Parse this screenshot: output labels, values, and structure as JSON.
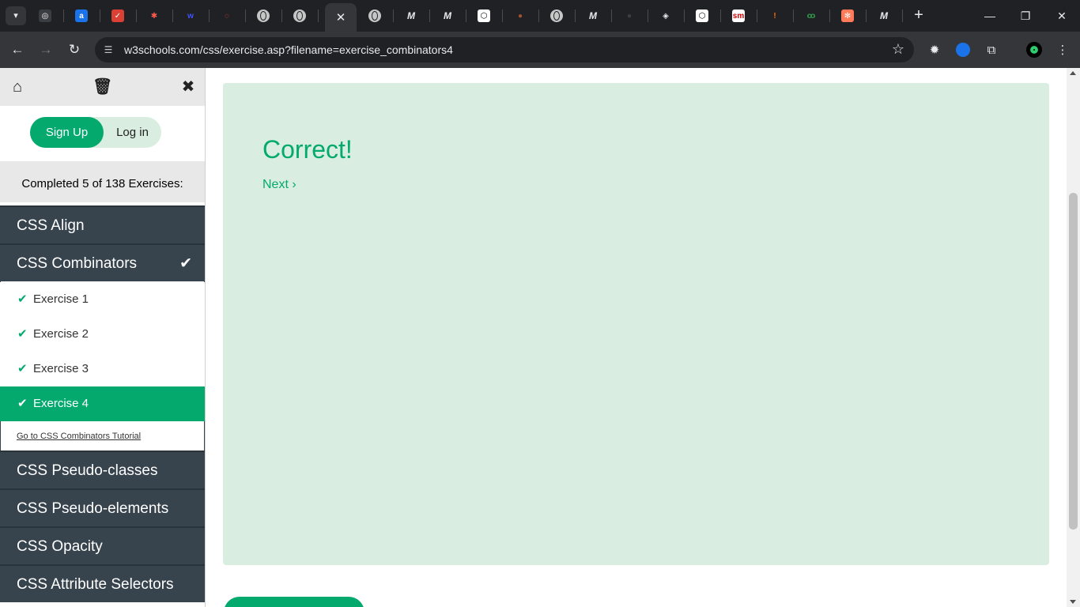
{
  "browser": {
    "tab_search_icon": "chevron-down-icon",
    "active_tab_close": "✕",
    "new_tab": "+",
    "window_controls": [
      "—",
      "❐",
      "✕"
    ],
    "favicons": [
      {
        "name": "chatgpt-favicon",
        "glyph": "◎",
        "bg": "#3a3d41"
      },
      {
        "name": "amazon-favicon",
        "glyph": "a",
        "bg": "#1a73e8"
      },
      {
        "name": "todoist-favicon",
        "glyph": "✓",
        "bg": "#db4035"
      },
      {
        "name": "asterisk-favicon",
        "glyph": "✱",
        "bg": "transparent",
        "color": "#ff5a4e"
      },
      {
        "name": "webflow-favicon",
        "glyph": "w",
        "bg": "transparent",
        "color": "#4353ff"
      },
      {
        "name": "circle-favicon",
        "glyph": "◌",
        "bg": "transparent",
        "color": "#ff4f4f"
      },
      {
        "name": "globe-favicon-1",
        "glyph": "",
        "bg": "globe"
      },
      {
        "name": "globe-favicon-2",
        "glyph": "",
        "bg": "globe"
      }
    ],
    "favicons_right": [
      {
        "name": "globe-favicon-3",
        "glyph": "",
        "bg": "globe"
      },
      {
        "name": "medium-favicon-1",
        "glyph": "M",
        "bg": "m"
      },
      {
        "name": "medium-favicon-2",
        "glyph": "M",
        "bg": "m"
      },
      {
        "name": "codepen-favicon-1",
        "glyph": "⬡",
        "bg": "#ffffff",
        "color": "#000"
      },
      {
        "name": "avatar-favicon",
        "glyph": "●",
        "bg": "transparent",
        "color": "#a0522d"
      },
      {
        "name": "globe-favicon-4",
        "glyph": "",
        "bg": "globe"
      },
      {
        "name": "medium-favicon-3",
        "glyph": "M",
        "bg": "m"
      },
      {
        "name": "dark-circle-favicon",
        "glyph": "●",
        "bg": "transparent",
        "color": "#3c4043"
      },
      {
        "name": "sketch-favicon",
        "glyph": "◈",
        "bg": "transparent",
        "color": "#e8eaed"
      },
      {
        "name": "codepen-favicon-2",
        "glyph": "⬡",
        "bg": "#ffffff",
        "color": "#000"
      },
      {
        "name": "sm-favicon",
        "glyph": "sm",
        "bg": "#ffffff",
        "color": "#c00"
      },
      {
        "name": "exclaim-favicon",
        "glyph": "!",
        "bg": "transparent",
        "color": "#ff6d00"
      },
      {
        "name": "geeks-favicon",
        "glyph": "ꝏ",
        "bg": "transparent",
        "color": "#2f8d46"
      },
      {
        "name": "hubspot-favicon",
        "glyph": "✻",
        "bg": "#ff7a59"
      },
      {
        "name": "medium-favicon-4",
        "glyph": "M",
        "bg": "m"
      }
    ]
  },
  "toolbar": {
    "url": "w3schools.com/css/exercise.asp?filename=exercise_combinators4"
  },
  "sidebar": {
    "signup_label": "Sign Up",
    "login_label": "Log in",
    "completed_text": "Completed 5 of 138 Exercises:",
    "sections_top": [
      {
        "label": "CSS Align",
        "checked": false
      },
      {
        "label": "CSS Combinators",
        "checked": true
      }
    ],
    "exercises": [
      {
        "label": "Exercise 1",
        "active": false
      },
      {
        "label": "Exercise 2",
        "active": false
      },
      {
        "label": "Exercise 3",
        "active": false
      },
      {
        "label": "Exercise 4",
        "active": true
      }
    ],
    "tutorial_link": "Go to CSS Combinators Tutorial",
    "sections_bottom": [
      {
        "label": "CSS Pseudo-classes"
      },
      {
        "label": "CSS Pseudo-elements"
      },
      {
        "label": "CSS Opacity"
      },
      {
        "label": "CSS Attribute Selectors"
      }
    ]
  },
  "main": {
    "result_title": "Correct!",
    "next_label": "Next"
  },
  "colors": {
    "accent": "#04aa6d",
    "panel_bg": "#d9eee1",
    "menu_bg": "#38444d"
  }
}
